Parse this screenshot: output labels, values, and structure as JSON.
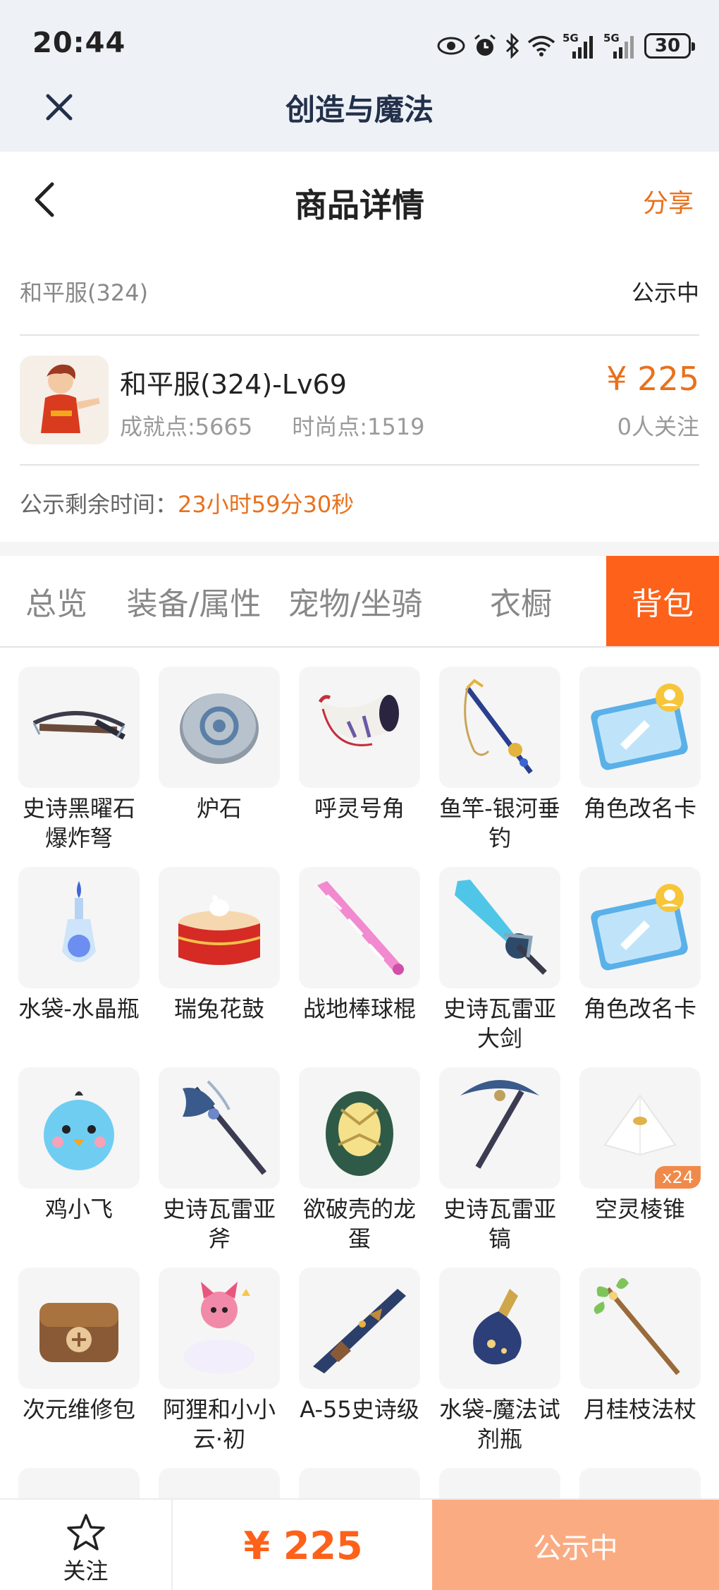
{
  "status_bar": {
    "time": "20:44",
    "signal_label": "5G",
    "battery": "30"
  },
  "app_bar": {
    "title": "创造与魔法"
  },
  "header": {
    "title": "商品详情",
    "share_label": "分享"
  },
  "server": {
    "name": "和平服(324)",
    "status": "公示中"
  },
  "product": {
    "name": "和平服(324)-Lv69",
    "achievement": "成就点:5665",
    "fashion": "时尚点:1519",
    "price": "¥ 225",
    "followers": "0人关注"
  },
  "countdown": {
    "label": "公示剩余时间：",
    "value": "23小时59分30秒"
  },
  "tabs": [
    {
      "label": "总览",
      "active": false
    },
    {
      "label": "装备/属性",
      "active": false
    },
    {
      "label": "宠物/坐骑",
      "active": false
    },
    {
      "label": "衣橱",
      "active": false
    },
    {
      "label": "背包",
      "active": true
    }
  ],
  "items": [
    {
      "label": "史诗黑曜石爆炸弩",
      "icon": "crossbow-icon"
    },
    {
      "label": "炉石",
      "icon": "hearthstone-icon"
    },
    {
      "label": "呼灵号角",
      "icon": "horn-icon"
    },
    {
      "label": "鱼竿-银河垂钓",
      "icon": "fishing-rod-icon"
    },
    {
      "label": "角色改名卡",
      "icon": "rename-card-icon"
    },
    {
      "label": "水袋-水晶瓶",
      "icon": "crystal-bottle-icon"
    },
    {
      "label": "瑞兔花鼓",
      "icon": "drum-icon"
    },
    {
      "label": "战地棒球棍",
      "icon": "baseball-bat-icon"
    },
    {
      "label": "史诗瓦雷亚大剑",
      "icon": "greatsword-icon"
    },
    {
      "label": "角色改名卡",
      "icon": "rename-card-icon"
    },
    {
      "label": "鸡小飞",
      "icon": "chick-pet-icon"
    },
    {
      "label": "史诗瓦雷亚斧",
      "icon": "axe-icon"
    },
    {
      "label": "欲破壳的龙蛋",
      "icon": "dragon-egg-icon"
    },
    {
      "label": "史诗瓦雷亚镐",
      "icon": "pickaxe-icon"
    },
    {
      "label": "空灵棱锥",
      "icon": "pyramid-icon",
      "badge": "x24"
    },
    {
      "label": "次元维修包",
      "icon": "repair-bag-icon"
    },
    {
      "label": "阿狸和小小云·初",
      "icon": "fox-cloud-icon"
    },
    {
      "label": "A-55史诗级",
      "icon": "rifle-icon"
    },
    {
      "label": "水袋-魔法试剂瓶",
      "icon": "potion-bottle-icon"
    },
    {
      "label": "月桂枝法杖",
      "icon": "staff-icon"
    }
  ],
  "bottom_bar": {
    "follow_label": "关注",
    "price": "¥ 225",
    "status_button": "公示中"
  },
  "colors": {
    "accent": "#fe6119",
    "price": "#e8711c",
    "status_button": "#fbab82",
    "app_bar_bg": "#eef2f7"
  }
}
